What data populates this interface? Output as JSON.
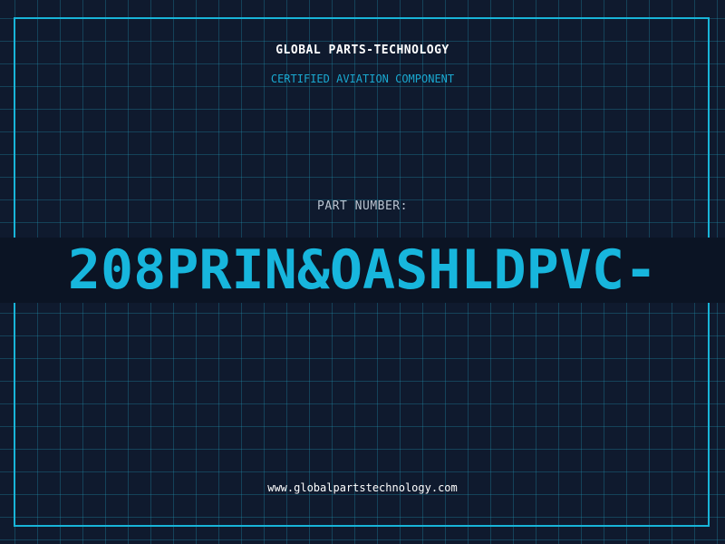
{
  "header": {
    "company_name": "GLOBAL PARTS-TECHNOLOGY",
    "subtitle": "CERTIFIED AVIATION COMPONENT"
  },
  "part": {
    "label": "PART NUMBER:",
    "number": "208PRIN&OASHLDPVC-"
  },
  "footer": {
    "website": "www.globalpartstechnology.com"
  },
  "colors": {
    "background": "#0f1a2e",
    "grid": "#2296b4",
    "accent": "#17b6dd",
    "band": "#0b1424"
  }
}
